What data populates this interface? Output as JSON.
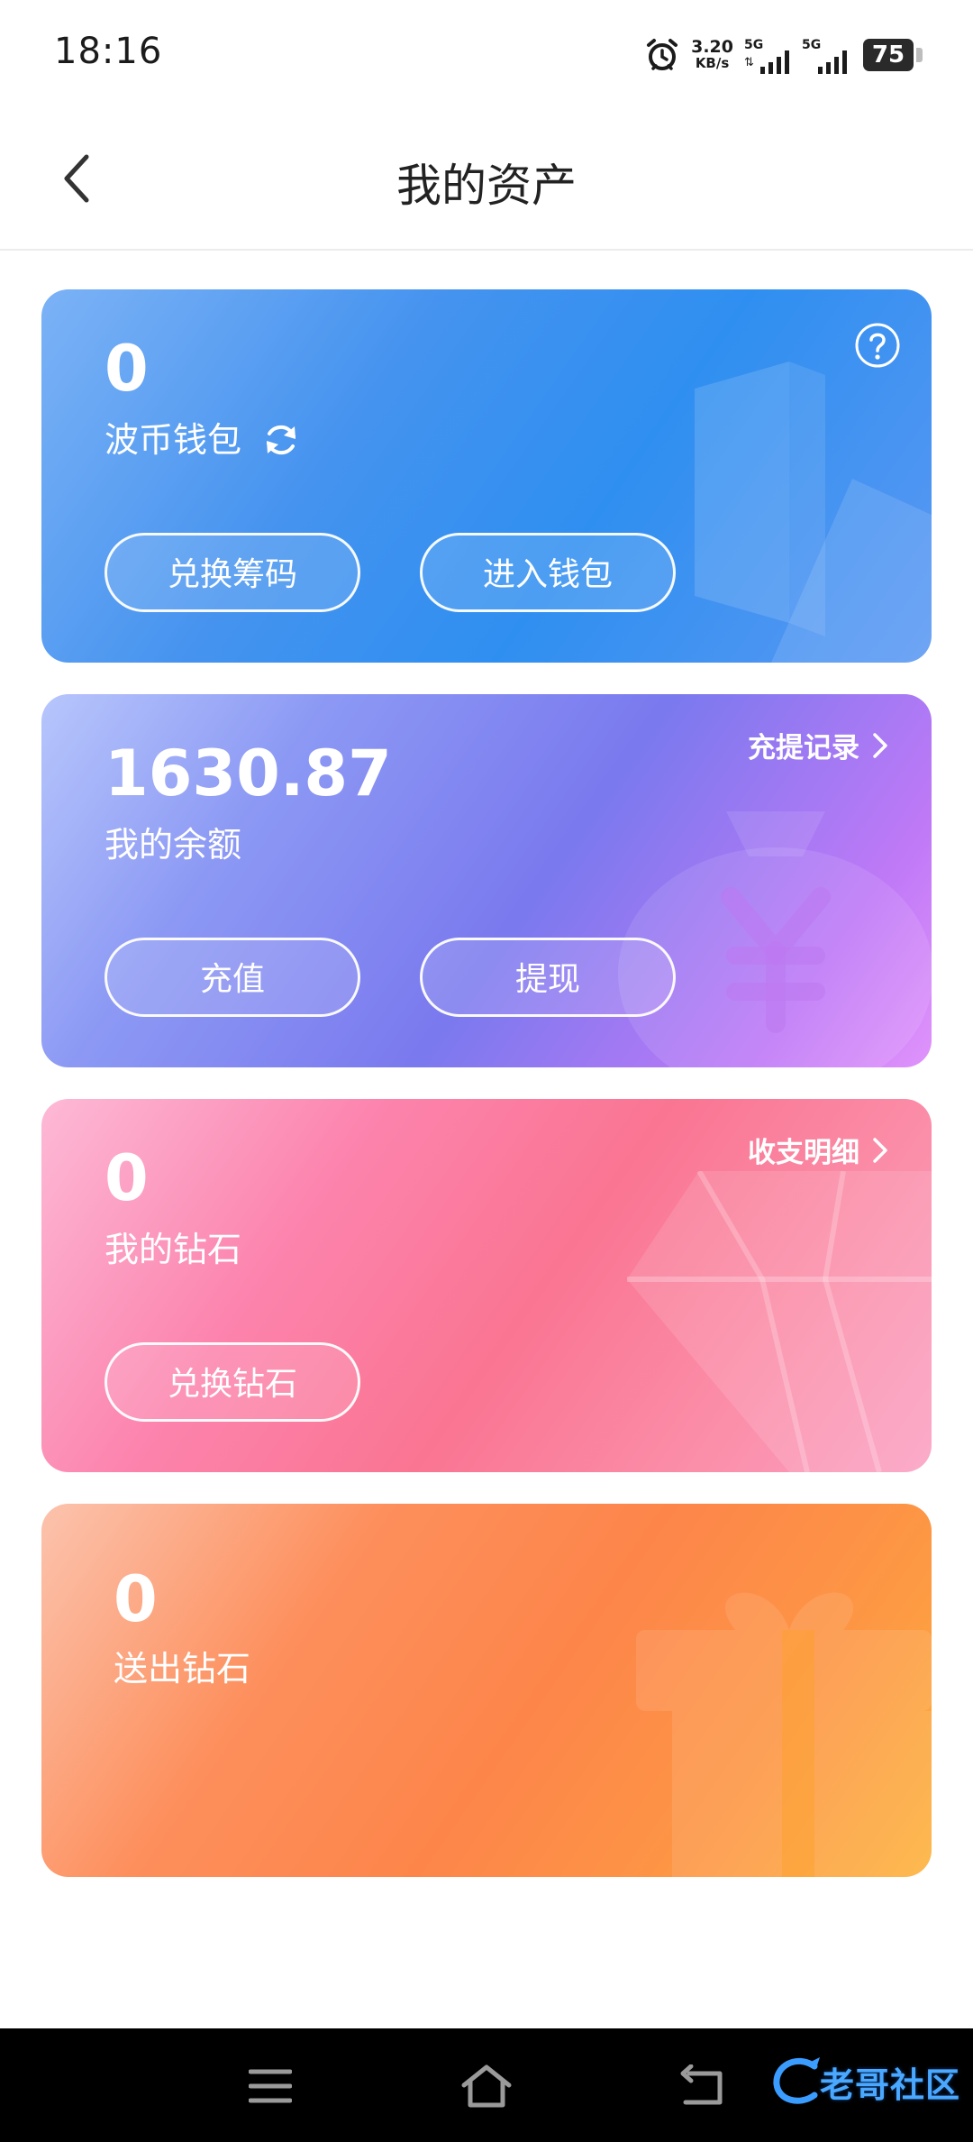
{
  "status_bar": {
    "time": "18:16",
    "net_speed_value": "3.20",
    "net_speed_unit": "KB/s",
    "sim1_label": "5G",
    "sim2_label": "5G",
    "battery": "75"
  },
  "header": {
    "title": "我的资产"
  },
  "cards": {
    "wallet": {
      "value": "0",
      "label": "波币钱包",
      "button_left": "兑换筹码",
      "button_right": "进入钱包"
    },
    "balance": {
      "value": "1630.87",
      "label": "我的余额",
      "link": "充提记录",
      "button_left": "充值",
      "button_right": "提现"
    },
    "diamond": {
      "value": "0",
      "label": "我的钻石",
      "link": "收支明细",
      "button_left": "兑换钻石"
    },
    "gift": {
      "value": "0",
      "label": "送出钻石"
    }
  },
  "watermark": {
    "text": "老哥社区"
  },
  "icons": {
    "back": "chevron-left-icon",
    "help": "question-circle-icon",
    "refresh": "refresh-icon",
    "link_arrow": "chevron-right-icon",
    "nav_menu": "menu-icon",
    "nav_home": "home-icon",
    "nav_back": "back-icon"
  }
}
